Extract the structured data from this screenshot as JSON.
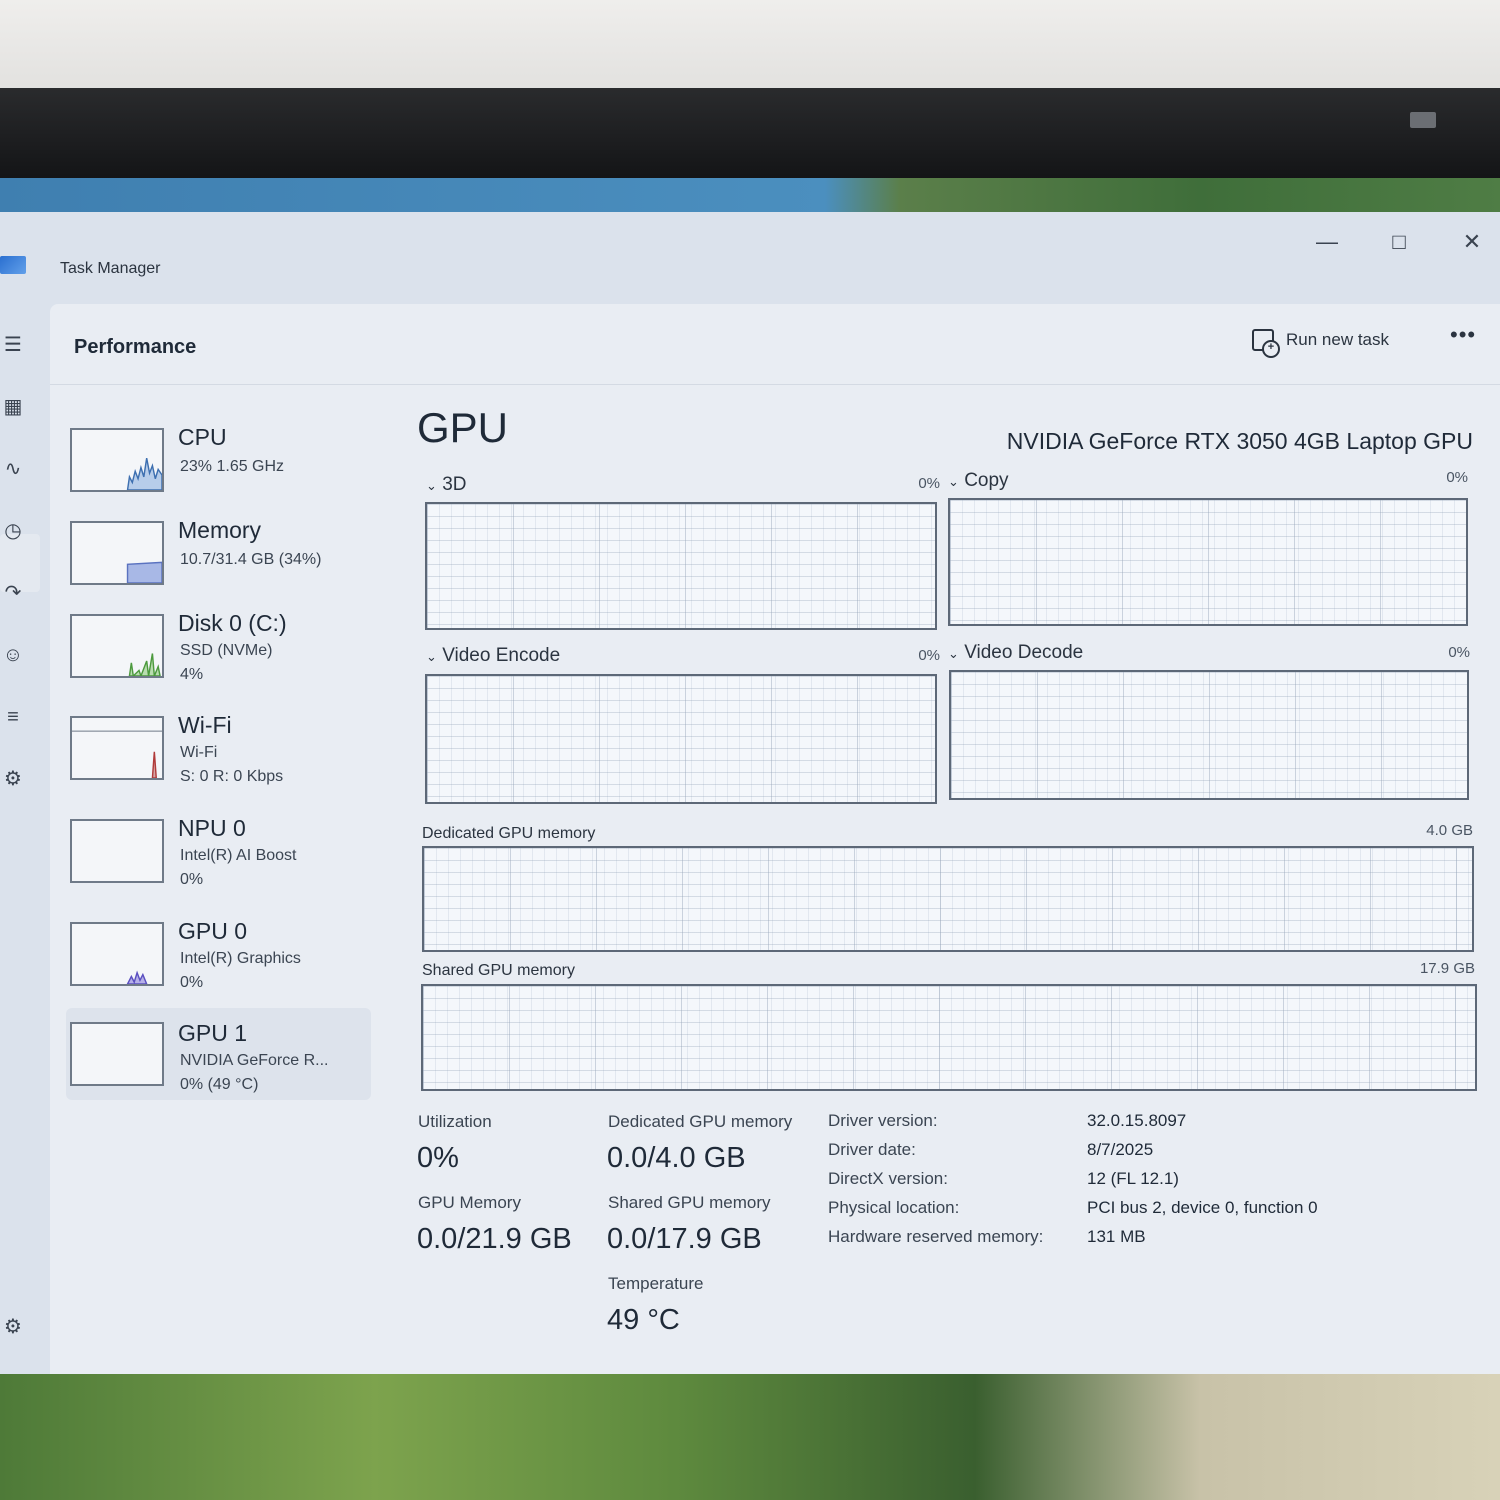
{
  "window": {
    "title": "Task Manager"
  },
  "header": {
    "section": "Performance",
    "run_new_task": "Run new task",
    "more": "•••"
  },
  "sidebar": [
    {
      "name": "CPU",
      "sub1": "23%  1.65 GHz",
      "sub2": ""
    },
    {
      "name": "Memory",
      "sub1": "10.7/31.4 GB (34%)",
      "sub2": ""
    },
    {
      "name": "Disk 0 (C:)",
      "sub1": "SSD (NVMe)",
      "sub2": "4%"
    },
    {
      "name": "Wi-Fi",
      "sub1": "Wi-Fi",
      "sub2": "S: 0  R: 0 Kbps"
    },
    {
      "name": "NPU 0",
      "sub1": "Intel(R) AI Boost",
      "sub2": "0%"
    },
    {
      "name": "GPU 0",
      "sub1": "Intel(R) Graphics",
      "sub2": "0%"
    },
    {
      "name": "GPU 1",
      "sub1": "NVIDIA GeForce R...",
      "sub2": "0%  (49 °C)"
    }
  ],
  "main": {
    "title": "GPU",
    "model": "NVIDIA GeForce RTX 3050 4GB Laptop GPU",
    "graphs": [
      {
        "label": "3D",
        "max": "0%"
      },
      {
        "label": "Copy",
        "max": "0%"
      },
      {
        "label": "Video Encode",
        "max": "0%"
      },
      {
        "label": "Video Decode",
        "max": "0%"
      },
      {
        "label": "Dedicated GPU memory",
        "max": "4.0 GB"
      },
      {
        "label": "Shared GPU memory",
        "max": "17.9 GB"
      }
    ],
    "stats": {
      "utilization_label": "Utilization",
      "utilization_value": "0%",
      "gpu_memory_label": "GPU Memory",
      "gpu_memory_value": "0.0/21.9 GB",
      "dedicated_label": "Dedicated GPU memory",
      "dedicated_value": "0.0/4.0 GB",
      "shared_label": "Shared GPU memory",
      "shared_value": "0.0/17.9 GB",
      "temp_label": "Temperature",
      "temp_value": "49 °C"
    },
    "info": [
      {
        "key": "Driver version:",
        "value": "32.0.15.8097"
      },
      {
        "key": "Driver date:",
        "value": "8/7/2025"
      },
      {
        "key": "DirectX version:",
        "value": "12 (FL 12.1)"
      },
      {
        "key": "Physical location:",
        "value": "PCI bus 2, device 0, function 0"
      },
      {
        "key": "Hardware reserved memory:",
        "value": "131 MB"
      }
    ]
  },
  "icons": [
    "hamburger-icon",
    "processes-icon",
    "performance-icon",
    "app-history-icon",
    "startup-icon",
    "users-icon",
    "details-icon",
    "services-icon",
    "settings-icon"
  ]
}
